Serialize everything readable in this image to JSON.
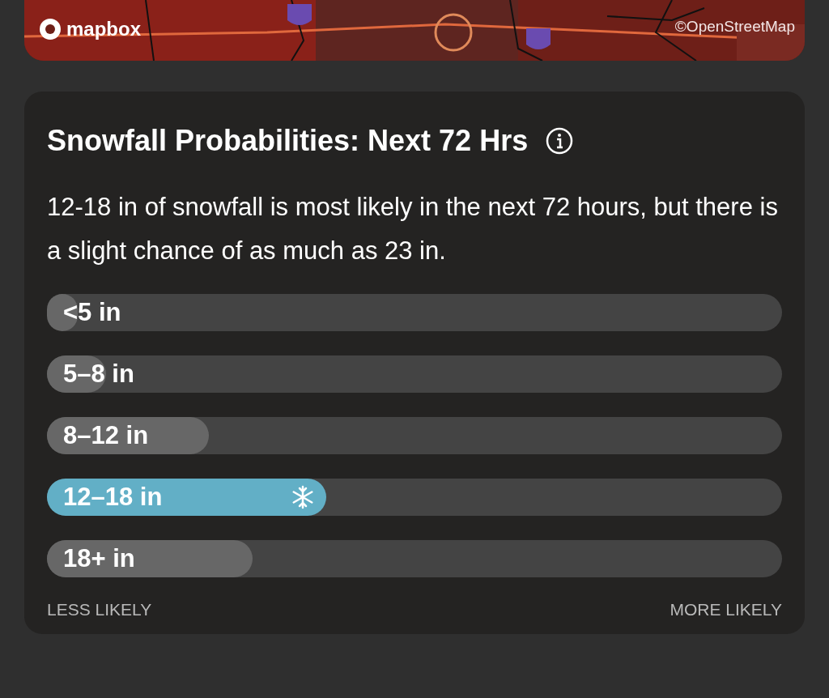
{
  "map": {
    "kind": "picture",
    "logo": "mapbox",
    "attribution": "©OpenStreetMap"
  },
  "card": {
    "title": "Snowfall Probabilities: Next 72 Hrs",
    "summary": "12-18 in of snowfall is most likely in the next 72 hours, but there is a slight chance of as much as 23 in.",
    "bars": [
      {
        "label": "<5 in",
        "level": 0.04,
        "selected": false
      },
      {
        "label": "5–8 in",
        "level": 0.08,
        "selected": false
      },
      {
        "label": "8–12 in",
        "level": 0.22,
        "selected": false
      },
      {
        "label": "12–18 in",
        "level": 0.38,
        "selected": true
      },
      {
        "label": "18+ in",
        "level": 0.28,
        "selected": false
      }
    ],
    "scale_left": "LESS LIKELY",
    "scale_right": "MORE LIKELY"
  }
}
